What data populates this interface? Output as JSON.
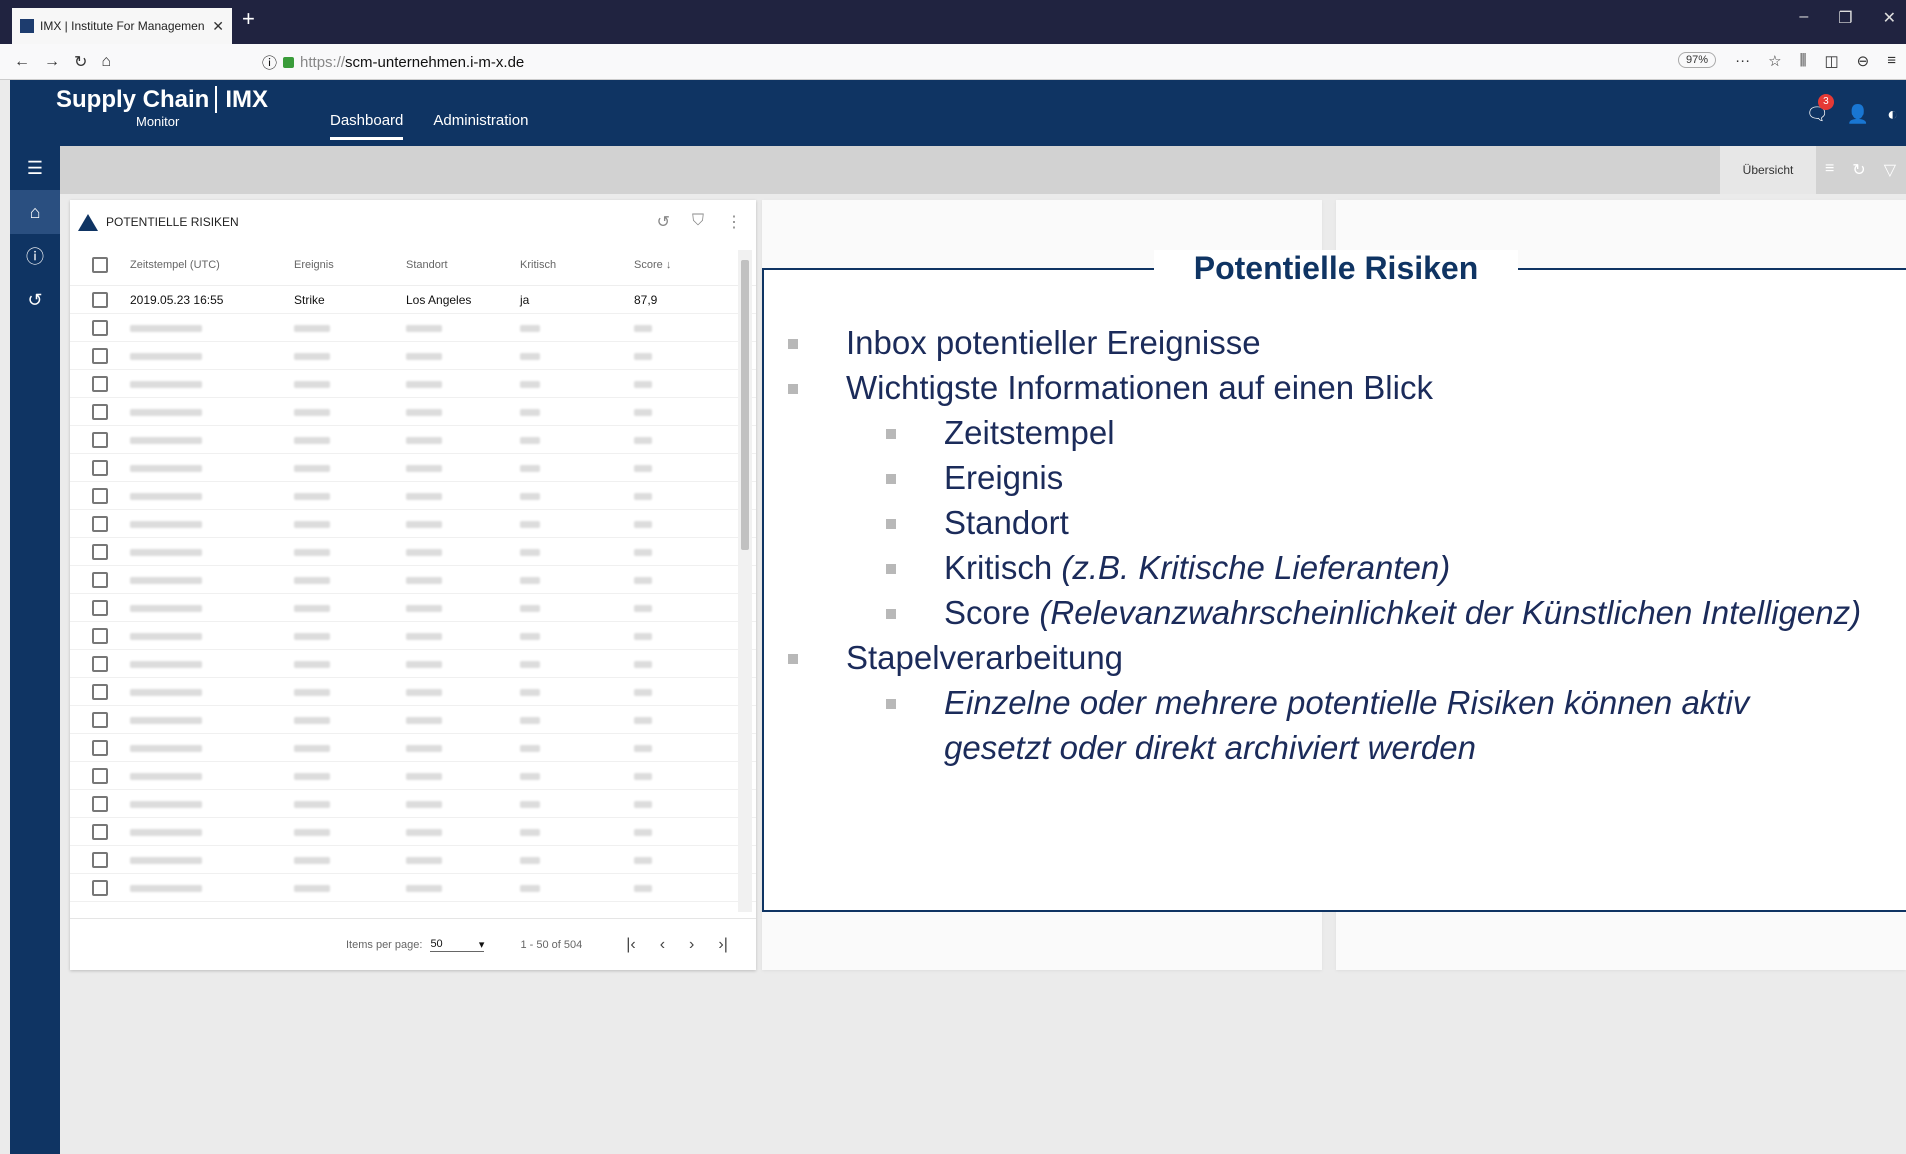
{
  "browser": {
    "tab_title": "IMX | Institute For Managemen",
    "url_scheme": "https://",
    "url_host": "scm-unternehmen.i-m-x.de",
    "zoom": "97%"
  },
  "app": {
    "logo_line1": "Supply Chain",
    "logo_brand": "IMX",
    "logo_line2": "Monitor",
    "nav": [
      "Dashboard",
      "Administration"
    ],
    "notification_count": "3"
  },
  "toolbar": {
    "uebersicht_label": "Übersicht"
  },
  "table": {
    "title": "POTENTIELLE RISIKEN",
    "columns": [
      "Zeitstempel (UTC)",
      "Ereignis",
      "Standort",
      "Kritisch",
      "Score"
    ],
    "first_row": [
      "2019.05.23 16:55",
      "Strike",
      "Los Angeles",
      "ja",
      "87,9"
    ],
    "blurred_row_count": 21,
    "items_per_page_label": "Items per page:",
    "items_per_page": "50",
    "range": "1 - 50 of 504"
  },
  "overlay": {
    "title": "Potentielle Risiken",
    "bullets": [
      {
        "level": 1,
        "text": "Inbox potentieller Ereignisse"
      },
      {
        "level": 1,
        "text": "Wichtigste Informationen auf einen Blick"
      },
      {
        "level": 2,
        "text": "Zeitstempel"
      },
      {
        "level": 2,
        "text": "Ereignis"
      },
      {
        "level": 2,
        "text": "Standort"
      },
      {
        "level": 2,
        "text": "Kritisch",
        "note": "(z.B. Kritische Lieferanten)"
      },
      {
        "level": 2,
        "text": "Score",
        "note": "(Relevanzwahrscheinlichkeit der Künstlichen Intelligenz)"
      },
      {
        "level": 1,
        "text": "Stapelverarbeitung"
      },
      {
        "level": 2,
        "text": "",
        "note": "Einzelne oder mehrere potentielle Risiken können aktiv"
      },
      {
        "level": 2,
        "text": "",
        "note": "gesetzt oder direkt archiviert werden",
        "nobullet": true
      }
    ]
  }
}
